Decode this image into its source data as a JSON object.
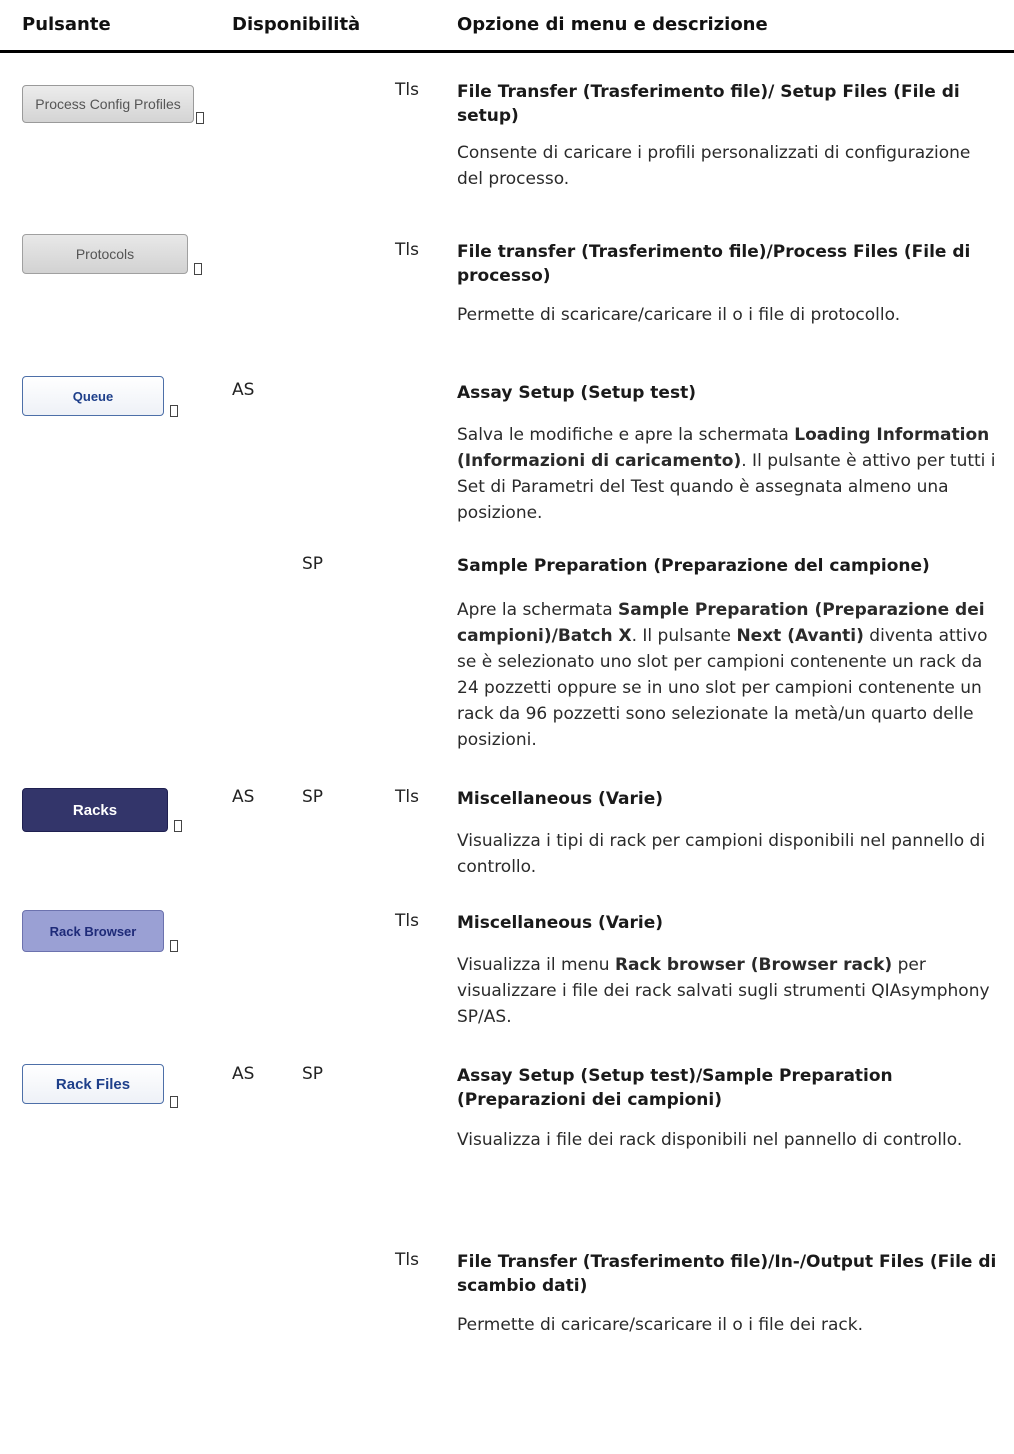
{
  "header": {
    "col_button": "Pulsante",
    "col_availability": "Disponibilità",
    "col_menu": "Opzione di menu e descrizione"
  },
  "rows": [
    {
      "button_label": "Process Config Profiles",
      "as": "",
      "sp": "",
      "tls": "Tls",
      "menu": "File Transfer (Trasferimento file)/ Setup Files (File di setup)",
      "desc": "Consente di caricare i profili personalizzati di configurazione del processo."
    },
    {
      "button_label": "Protocols",
      "as": "",
      "sp": "",
      "tls": "Tls",
      "menu": "File transfer (Trasferimento file)/Process Files (File di processo)",
      "desc": "Permette di scaricare/caricare il o i file di protocollo."
    },
    {
      "button_label": "Queue",
      "as": "AS",
      "sp": "",
      "tls": "",
      "menu": "Assay Setup (Setup test)",
      "desc_1": "Salva le modifiche e apre la schermata ",
      "desc_b1": "Loading Information (Informazioni di caricamento)",
      "desc_2": ". Il pulsante è attivo per tutti i Set di Parametri del Test quando è assegnata almeno una posizione."
    },
    {
      "button_label": "",
      "as": "",
      "sp": "SP",
      "tls": "",
      "menu": "Sample Preparation (Preparazione del campione)",
      "desc_1": "Apre la schermata ",
      "desc_b1": "Sample Preparation (Preparazione dei campioni)/Batch X",
      "desc_2": ". Il pulsante ",
      "desc_b2": "Next (Avanti)",
      "desc_3": " diventa attivo se è selezionato uno slot per campioni contenente un rack da 24 pozzetti oppure se in uno slot per campioni contenente un rack da 96 pozzetti sono selezionate la metà/un quarto delle posizioni."
    },
    {
      "button_label": "Racks",
      "as": "AS",
      "sp": "SP",
      "tls": "Tls",
      "menu": "Miscellaneous (Varie)",
      "desc": "Visualizza i tipi di rack per campioni disponibili nel pannello di controllo."
    },
    {
      "button_label": "Rack Browser",
      "as": "",
      "sp": "",
      "tls": "Tls",
      "menu": "Miscellaneous (Varie)",
      "desc_1": "Visualizza il menu ",
      "desc_b1": "Rack browser (Browser rack)",
      "desc_2": " per visualizzare i file dei rack salvati sugli strumenti QIAsymphony SP/AS."
    },
    {
      "button_label": "Rack Files",
      "as": "AS",
      "sp": "SP",
      "tls": "",
      "menu": "Assay Setup (Setup test)/Sample Preparation (Preparazioni dei campioni)",
      "desc": "Visualizza i file dei rack disponibili nel pannello di controllo."
    },
    {
      "button_label": "",
      "as": "",
      "sp": "",
      "tls": "Tls",
      "menu": "File Transfer (Trasferimento file)/In-/Output Files (File di scambio dati)",
      "desc": "Permette di caricare/scaricare il o i file dei rack."
    }
  ]
}
